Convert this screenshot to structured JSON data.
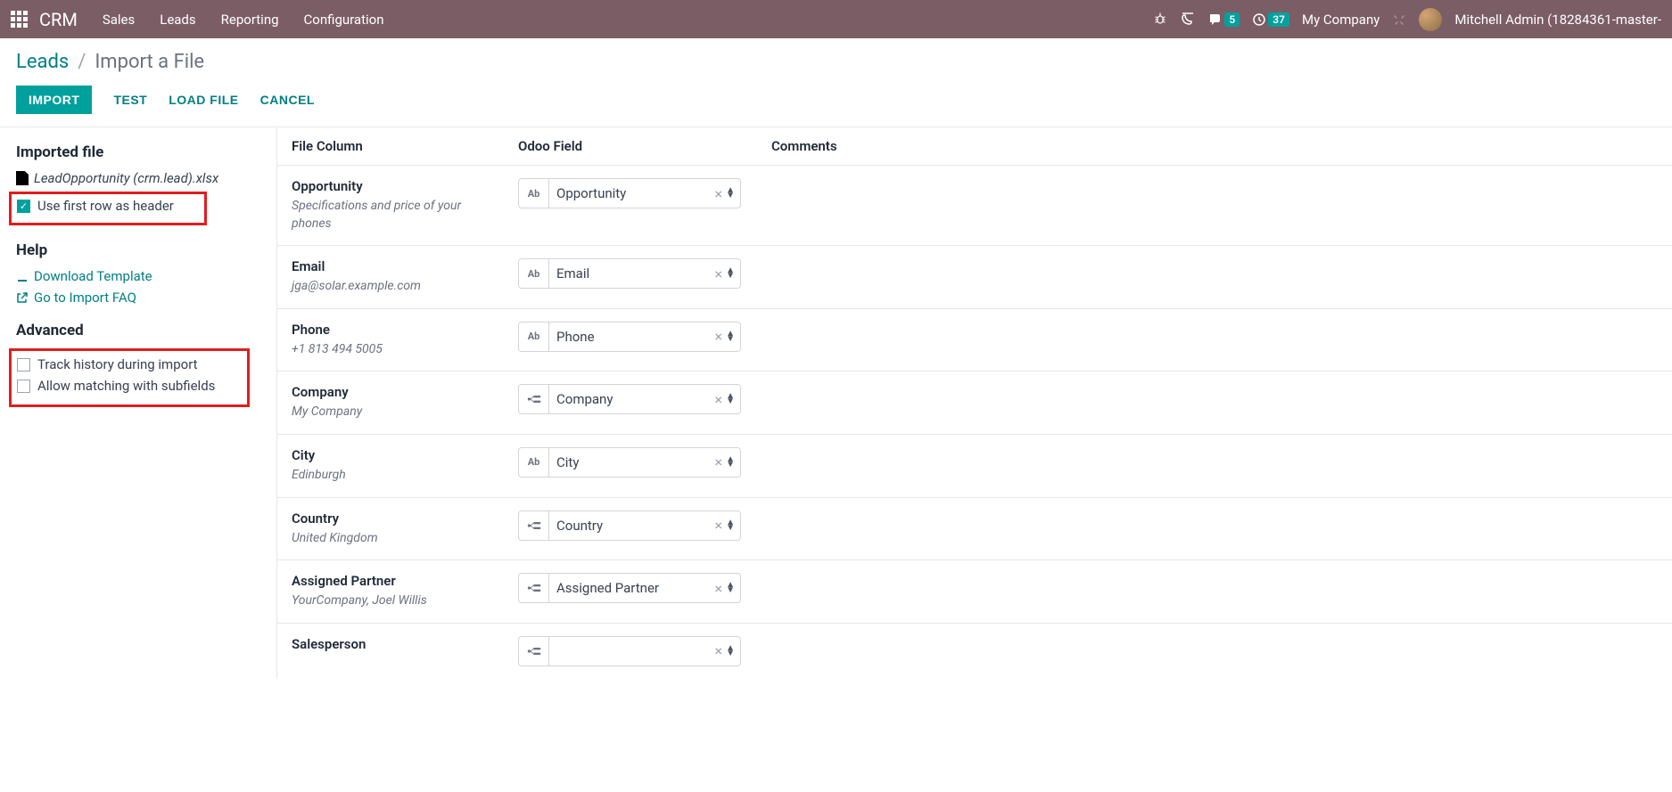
{
  "navbar": {
    "brand": "CRM",
    "links": [
      "Sales",
      "Leads",
      "Reporting",
      "Configuration"
    ],
    "messages_badge": "5",
    "activity_badge": "37",
    "company": "My Company",
    "username": "Mitchell Admin (18284361-master-"
  },
  "breadcrumb": {
    "parent": "Leads",
    "current": "Import a File"
  },
  "actions": {
    "import": "IMPORT",
    "test": "TEST",
    "load_file": "LOAD FILE",
    "cancel": "CANCEL"
  },
  "sidebar": {
    "imported_file": {
      "title": "Imported file",
      "filename": "LeadOpportunity (crm.lead).xlsx",
      "use_first_row": "Use first row as header"
    },
    "help": {
      "title": "Help",
      "download": "Download Template",
      "faq": "Go to Import FAQ"
    },
    "advanced": {
      "title": "Advanced",
      "track_history": "Track history during import",
      "allow_subfields": "Allow matching with subfields"
    }
  },
  "columns": {
    "file_column": "File Column",
    "odoo_field": "Odoo Field",
    "comments": "Comments"
  },
  "mappings": [
    {
      "name": "Opportunity",
      "sample": "Specifications and price of your phones",
      "field": "Opportunity",
      "type": "text"
    },
    {
      "name": "Email",
      "sample": "jga@solar.example.com",
      "field": "Email",
      "type": "text"
    },
    {
      "name": "Phone",
      "sample": "+1 813 494 5005",
      "field": "Phone",
      "type": "text"
    },
    {
      "name": "Company",
      "sample": "My Company",
      "field": "Company",
      "type": "rel"
    },
    {
      "name": "City",
      "sample": "Edinburgh",
      "field": "City",
      "type": "text"
    },
    {
      "name": "Country",
      "sample": "United Kingdom",
      "field": "Country",
      "type": "rel"
    },
    {
      "name": "Assigned Partner",
      "sample": "YourCompany, Joel Willis",
      "field": "Assigned Partner",
      "type": "rel"
    },
    {
      "name": "Salesperson",
      "sample": "",
      "field": "",
      "type": "rel"
    }
  ]
}
